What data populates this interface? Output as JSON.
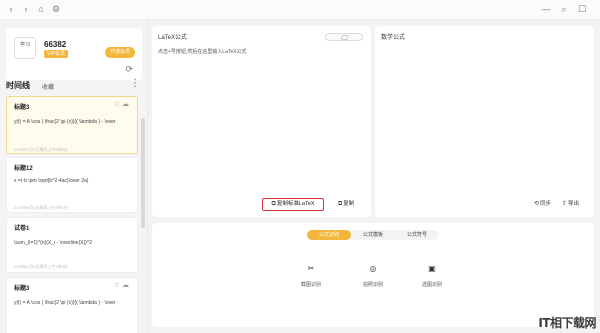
{
  "window": {
    "nav_back_icon": "chevron-left-icon",
    "nav_forward_icon": "chevron-right-icon",
    "home_icon": "home-icon",
    "settings_icon": "gear-icon",
    "minimize_icon": "minimize-icon",
    "search_icon": "search-icon",
    "maximize_icon": "maximize-icon",
    "close_icon": "close-icon"
  },
  "user": {
    "avatar_text": "学习",
    "id": "66382",
    "vip_tag": "VIP会员",
    "member_button": "开通会员"
  },
  "timeline": {
    "title": "时间线",
    "favorites": "收藏",
    "notes": [
      {
        "title": "标题3",
        "formula": "y(t) = A \\cos ( \\frac{2 \\pi (x)}{( \\lambda ) - \\over",
        "time": "2025年9月4日周四上午8时5分"
      },
      {
        "title": "标题12",
        "formula": "x =(-b \\pm \\sqrt{b^2-4ac}\\over 2a)",
        "time": "2025年9月4日周四上午8时0分"
      },
      {
        "title": "试卷1",
        "formula": "\\sum_{i=1}^{n}(X_i - \\overline{X})^2",
        "time": "2025年9月4日周四上午7时3分"
      },
      {
        "title": "标题3",
        "formula": "y(t) = A \\cos ( \\frac{2 \\pi (x)}{( \\lambda ) - \\over",
        "time": ""
      }
    ]
  },
  "latex_panel": {
    "title": "LaTeX公式",
    "hint": "点击+号按钮,然后在这里输入LaTeX公式",
    "copy_standard": "复制标准LaTeX",
    "copy": "复制"
  },
  "math_panel": {
    "title": "数学公式",
    "sync": "同步",
    "export": "导出"
  },
  "bottom": {
    "tabs": [
      "公式识别",
      "公式模板",
      "公式符号"
    ],
    "tools": [
      {
        "label": "截图识别",
        "icon": "scissors-icon"
      },
      {
        "label": "拍照识别",
        "icon": "camera-icon"
      },
      {
        "label": "选图识别",
        "icon": "image-icon"
      }
    ]
  },
  "watermark": "IT相下载网"
}
